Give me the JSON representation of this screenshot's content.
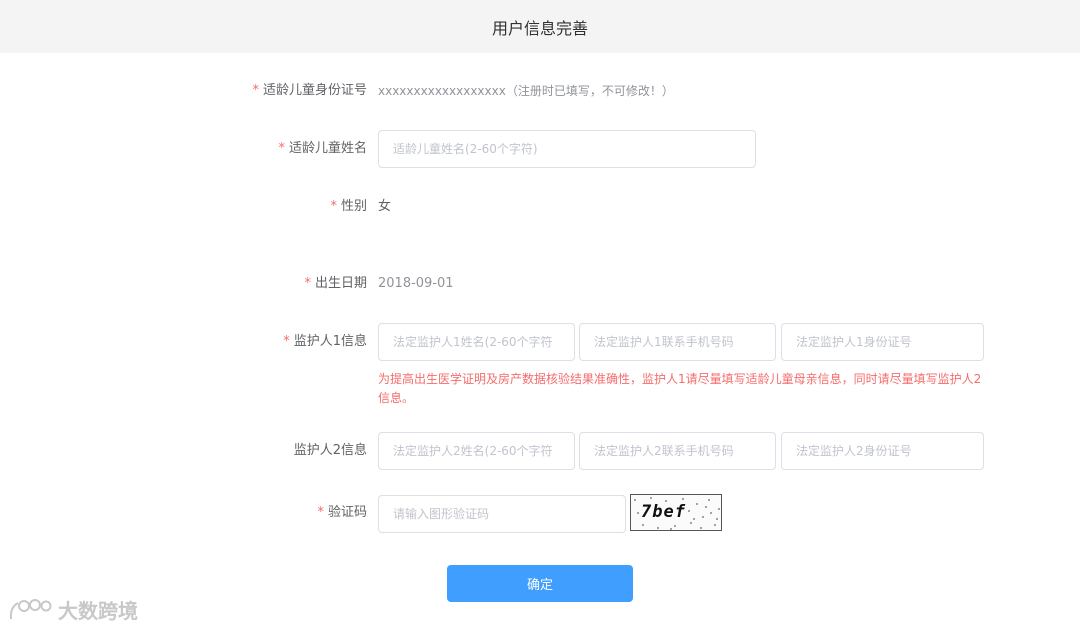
{
  "header": {
    "title": "用户信息完善"
  },
  "form": {
    "id_card": {
      "label": "适龄儿童身份证号",
      "value": "xxxxxxxxxxxxxxxxxx",
      "note": "（注册时已填写，不可修改！）"
    },
    "child_name": {
      "label": "适龄儿童姓名",
      "placeholder": "适龄儿童姓名(2-60个字符)",
      "value": ""
    },
    "gender": {
      "label": "性别",
      "value": "女"
    },
    "birth_date": {
      "label": "出生日期",
      "value": "2018-09-01"
    },
    "guardian1": {
      "label": "监护人1信息",
      "name_placeholder": "法定监护人1姓名(2-60个字符",
      "phone_placeholder": "法定监护人1联系手机号码",
      "id_placeholder": "法定监护人1身份证号",
      "warning": "为提高出生医学证明及房产数据核验结果准确性，监护人1请尽量填写适龄儿童母亲信息，同时请尽量填写监护人2信息。"
    },
    "guardian2": {
      "label": "监护人2信息",
      "name_placeholder": "法定监护人2姓名(2-60个字符",
      "phone_placeholder": "法定监护人2联系手机号码",
      "id_placeholder": "法定监护人2身份证号"
    },
    "captcha": {
      "label": "验证码",
      "placeholder": "请输入图形验证码",
      "image_text": "7bef"
    },
    "required_mark": "*",
    "submit_label": "确定"
  },
  "watermark": {
    "text": "大数跨境"
  },
  "colors": {
    "primary": "#409eff",
    "required": "#f56c6c",
    "warning": "#f56c6c",
    "header_bg": "#f4f4f5"
  }
}
